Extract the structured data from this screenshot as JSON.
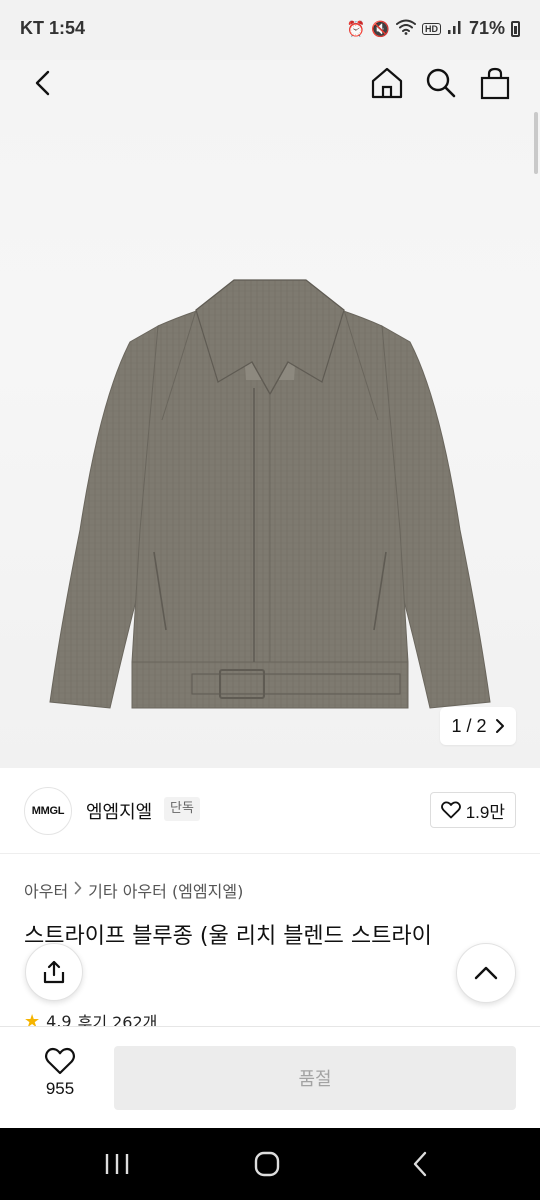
{
  "status_bar": {
    "carrier_time": "KT 1:54",
    "network_badge": "HD",
    "battery": "71%"
  },
  "nav": {
    "icons": [
      "back-icon",
      "home-icon",
      "search-icon",
      "shopping-bag-icon"
    ]
  },
  "gallery": {
    "current": "1",
    "separator": "/",
    "total": "2"
  },
  "brand": {
    "logo_text": "MMGL",
    "name": "엠엠지엘",
    "badge": "단독",
    "likes": "1.9만"
  },
  "breadcrumb": {
    "category": "아우터",
    "subcategory": "기타 아우터 (엠엠지엘)"
  },
  "product": {
    "title": "스트라이프 블루종 (울 리치 블렌드 스트라이",
    "rating": "4.9",
    "reviews": "후기 262개"
  },
  "bottom_bar": {
    "wish_count": "955",
    "action_label": "품절"
  },
  "colors": {
    "jacket": "#7e7a70",
    "accent_star": "#f5b400",
    "disabled_button": "#ececec"
  }
}
